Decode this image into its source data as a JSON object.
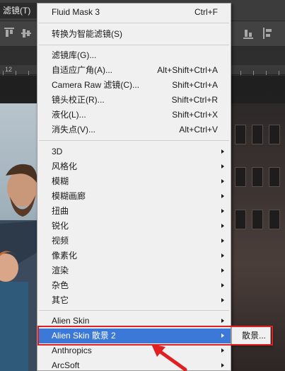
{
  "menubar": {
    "active_menu": "滤镜(T)"
  },
  "ruler": {
    "numbers": [
      "12"
    ]
  },
  "filter_menu": {
    "items": [
      {
        "label": "Fluid Mask 3",
        "shortcut": "Ctrl+F"
      },
      {
        "label": "转换为智能滤镜(S)",
        "shortcut": ""
      },
      {
        "label": "滤镜库(G)...",
        "shortcut": ""
      },
      {
        "label": "自适应广角(A)...",
        "shortcut": "Alt+Shift+Ctrl+A"
      },
      {
        "label": "Camera Raw 滤镜(C)...",
        "shortcut": "Shift+Ctrl+A"
      },
      {
        "label": "镜头校正(R)...",
        "shortcut": "Shift+Ctrl+R"
      },
      {
        "label": "液化(L)...",
        "shortcut": "Shift+Ctrl+X"
      },
      {
        "label": "消失点(V)...",
        "shortcut": "Alt+Ctrl+V"
      },
      {
        "label": "3D",
        "shortcut": ""
      },
      {
        "label": "风格化",
        "shortcut": ""
      },
      {
        "label": "模糊",
        "shortcut": ""
      },
      {
        "label": "模糊画廊",
        "shortcut": ""
      },
      {
        "label": "扭曲",
        "shortcut": ""
      },
      {
        "label": "锐化",
        "shortcut": ""
      },
      {
        "label": "视频",
        "shortcut": ""
      },
      {
        "label": "像素化",
        "shortcut": ""
      },
      {
        "label": "渲染",
        "shortcut": ""
      },
      {
        "label": "杂色",
        "shortcut": ""
      },
      {
        "label": "其它",
        "shortcut": ""
      },
      {
        "label": "Alien Skin",
        "shortcut": ""
      },
      {
        "label": "Alien Skin 散景 2",
        "shortcut": ""
      },
      {
        "label": "Anthropics",
        "shortcut": ""
      },
      {
        "label": "ArcSoft",
        "shortcut": ""
      }
    ],
    "active_item": "Alien Skin 散景 2"
  },
  "submenu": {
    "items": [
      {
        "label": "散景..."
      }
    ]
  },
  "colors": {
    "menu_bg": "#f0f0f0",
    "highlight": "#3c78d8",
    "annotation": "#e02020",
    "chrome": "#3c3c3c"
  },
  "icons": [
    "align-top-icon",
    "align-vcenter-icon",
    "align-bottom-icon",
    "submenu-arrow-icon",
    "annotation-arrow-icon"
  ]
}
